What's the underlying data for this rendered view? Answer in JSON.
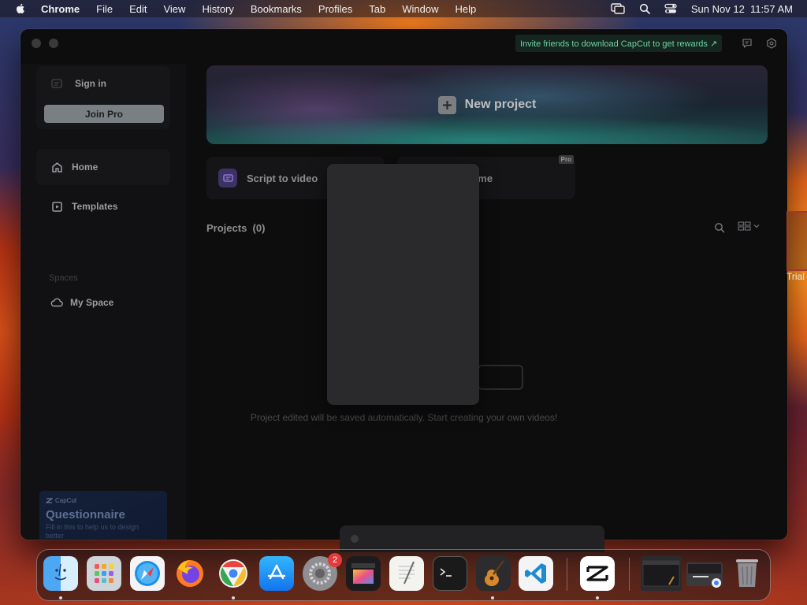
{
  "menubar": {
    "app_name": "Chrome",
    "items": [
      "File",
      "Edit",
      "View",
      "History",
      "Bookmarks",
      "Profiles",
      "Tab",
      "Window",
      "Help"
    ],
    "datetime": "Sun Nov 12  11:57 AM"
  },
  "window": {
    "invite_text": "Invite friends to download CapCut to get rewards ↗",
    "sidebar": {
      "sign_in": "Sign in",
      "join_pro": "Join Pro",
      "nav": [
        {
          "label": "Home",
          "icon": "home-icon",
          "active": true
        },
        {
          "label": "Templates",
          "icon": "templates-icon",
          "active": false
        }
      ],
      "spaces_label": "Spaces",
      "my_space": "My Space",
      "promo": {
        "brand": "CapCut",
        "title": "Questionnaire",
        "description": "Fill in this to help us to design better"
      }
    },
    "main": {
      "new_project": "New project",
      "features": [
        {
          "label": "Script to video",
          "icon": "script-icon"
        },
        {
          "label": "rame",
          "pro_tag": "Pro"
        }
      ],
      "projects_label": "Projects",
      "projects_count": "(0)",
      "empty_message": "Project edited will be saved automatically. Start creating your own videos!"
    }
  },
  "side_peek": {
    "text": "Trial"
  },
  "dock": {
    "apps": [
      {
        "name": "Finder",
        "icon": "finder-icon",
        "running": true
      },
      {
        "name": "Launchpad",
        "icon": "launchpad-icon",
        "running": false
      },
      {
        "name": "Safari",
        "icon": "safari-icon",
        "running": false
      },
      {
        "name": "Firefox",
        "icon": "firefox-icon",
        "running": false
      },
      {
        "name": "Google Chrome",
        "icon": "chrome-icon",
        "running": true
      },
      {
        "name": "App Store",
        "icon": "app-store-icon",
        "running": false
      },
      {
        "name": "System Settings",
        "icon": "settings-icon",
        "running": false,
        "badge": "2"
      },
      {
        "name": "Final Cut Pro",
        "icon": "final-cut-icon",
        "running": false
      },
      {
        "name": "TextEdit",
        "icon": "textedit-icon",
        "running": false
      },
      {
        "name": "Terminal",
        "icon": "terminal-icon",
        "running": false
      },
      {
        "name": "GarageBand",
        "icon": "garageband-icon",
        "running": true
      },
      {
        "name": "Visual Studio Code",
        "icon": "vscode-icon",
        "running": false
      },
      {
        "name": "CapCut",
        "icon": "capcut-icon",
        "running": true
      },
      {
        "name": "Recent Window",
        "icon": "window-thumbnail-icon",
        "running": false
      },
      {
        "name": "Downloads",
        "icon": "downloads-stack-icon",
        "running": false
      },
      {
        "name": "Trash",
        "icon": "trash-icon",
        "running": false
      }
    ]
  }
}
